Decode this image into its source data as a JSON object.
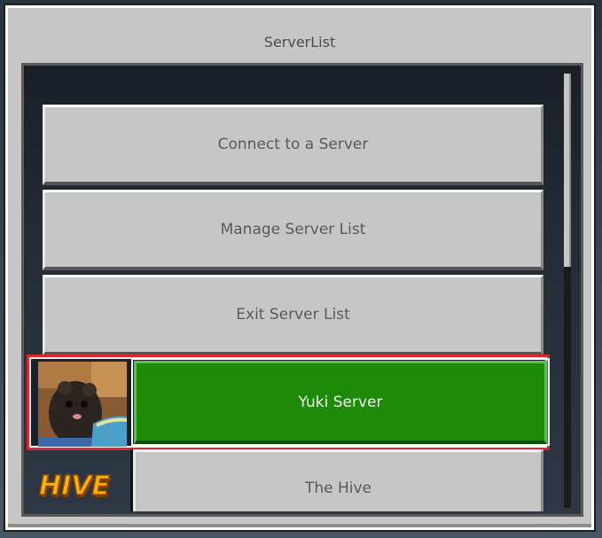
{
  "window": {
    "title": "ServerList"
  },
  "menu": {
    "connect_label": "Connect to a Server",
    "manage_label": "Manage Server List",
    "exit_label": "Exit Server List"
  },
  "servers": [
    {
      "name": "Yuki Server",
      "icon": "hamster-thumbnail-icon",
      "selected": true,
      "accent": "#1d8a0a"
    },
    {
      "name": "The Hive",
      "icon": "hive-logo-icon",
      "selected": false
    }
  ],
  "colors": {
    "selection_outline": "#e0242a",
    "selected_button": "#1d8a0a",
    "button_gray": "#c6c6c6"
  }
}
